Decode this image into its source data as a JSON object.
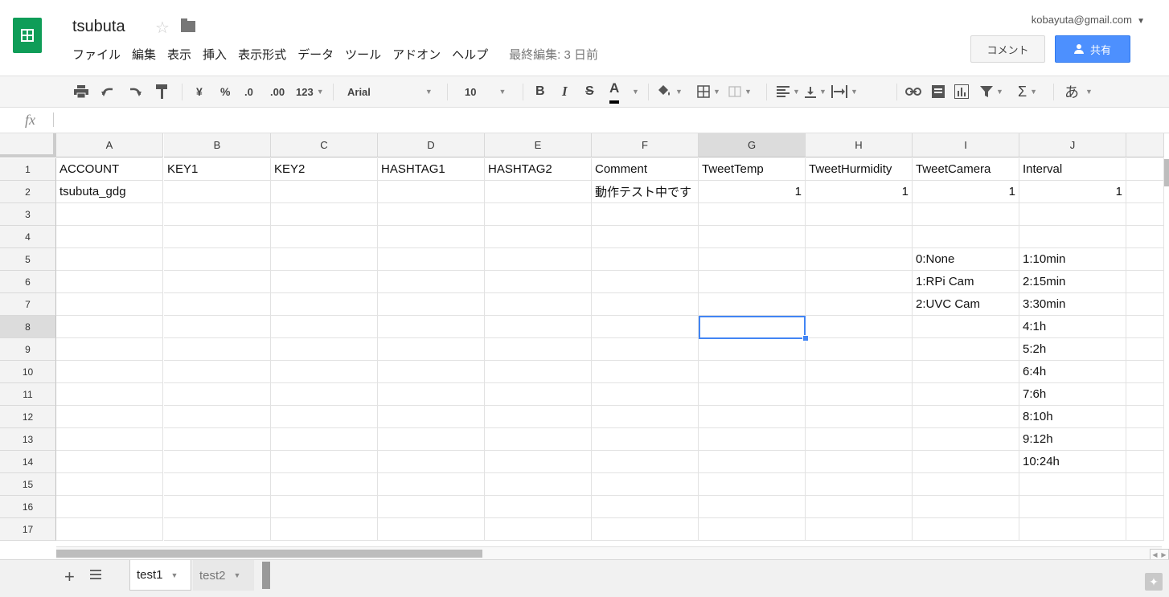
{
  "header": {
    "title": "tsubuta",
    "account": "kobayuta@gmail.com",
    "comment_label": "コメント",
    "share_label": "共有",
    "star_icon": "star-icon",
    "folder_icon": "folder-icon"
  },
  "menu": {
    "items": [
      "ファイル",
      "編集",
      "表示",
      "挿入",
      "表示形式",
      "データ",
      "ツール",
      "アドオン",
      "ヘルプ"
    ],
    "last_edit": "最終編集: 3 日前"
  },
  "toolbar": {
    "currency": "¥",
    "percent": "%",
    "dec_decrease": ".0",
    "dec_increase": ".00",
    "number_format": "123",
    "font": "Arial",
    "font_size": "10",
    "bold": "B",
    "italic": "I",
    "strike": "S",
    "text_color": "A",
    "sum": "Σ",
    "input_tools": "あ"
  },
  "formula_bar": {
    "fx": "fx",
    "value": ""
  },
  "grid": {
    "columns": [
      "A",
      "B",
      "C",
      "D",
      "E",
      "F",
      "G",
      "H",
      "I",
      "J"
    ],
    "active_column": "G",
    "active_row": "8",
    "rows": [
      {
        "num": "1",
        "cells": [
          "ACCOUNT",
          "KEY1",
          "KEY2",
          "HASHTAG1",
          "HASHTAG2",
          "Comment",
          "TweetTemp",
          "TweetHurmidity",
          "TweetCamera",
          "Interval"
        ]
      },
      {
        "num": "2",
        "cells": [
          "tsubuta_gdg",
          "",
          "",
          "",
          "",
          "動作テスト中です",
          "1",
          "1",
          "1",
          "1"
        ]
      },
      {
        "num": "3",
        "cells": [
          "",
          "",
          "",
          "",
          "",
          "",
          "",
          "",
          "",
          ""
        ]
      },
      {
        "num": "4",
        "cells": [
          "",
          "",
          "",
          "",
          "",
          "",
          "",
          "",
          "",
          ""
        ]
      },
      {
        "num": "5",
        "cells": [
          "",
          "",
          "",
          "",
          "",
          "",
          "",
          "",
          "0:None",
          "1:10min"
        ]
      },
      {
        "num": "6",
        "cells": [
          "",
          "",
          "",
          "",
          "",
          "",
          "",
          "",
          "1:RPi Cam",
          "2:15min"
        ]
      },
      {
        "num": "7",
        "cells": [
          "",
          "",
          "",
          "",
          "",
          "",
          "",
          "",
          "2:UVC Cam",
          "3:30min"
        ]
      },
      {
        "num": "8",
        "cells": [
          "",
          "",
          "",
          "",
          "",
          "",
          "",
          "",
          "",
          "4:1h"
        ]
      },
      {
        "num": "9",
        "cells": [
          "",
          "",
          "",
          "",
          "",
          "",
          "",
          "",
          "",
          "5:2h"
        ]
      },
      {
        "num": "10",
        "cells": [
          "",
          "",
          "",
          "",
          "",
          "",
          "",
          "",
          "",
          "6:4h"
        ]
      },
      {
        "num": "11",
        "cells": [
          "",
          "",
          "",
          "",
          "",
          "",
          "",
          "",
          "",
          "7:6h"
        ]
      },
      {
        "num": "12",
        "cells": [
          "",
          "",
          "",
          "",
          "",
          "",
          "",
          "",
          "",
          "8:10h"
        ]
      },
      {
        "num": "13",
        "cells": [
          "",
          "",
          "",
          "",
          "",
          "",
          "",
          "",
          "",
          "9:12h"
        ]
      },
      {
        "num": "14",
        "cells": [
          "",
          "",
          "",
          "",
          "",
          "",
          "",
          "",
          "",
          "10:24h"
        ]
      },
      {
        "num": "15",
        "cells": [
          "",
          "",
          "",
          "",
          "",
          "",
          "",
          "",
          "",
          ""
        ]
      },
      {
        "num": "16",
        "cells": [
          "",
          "",
          "",
          "",
          "",
          "",
          "",
          "",
          "",
          ""
        ]
      },
      {
        "num": "17",
        "cells": [
          "",
          "",
          "",
          "",
          "",
          "",
          "",
          "",
          "",
          ""
        ]
      }
    ]
  },
  "sheets": {
    "tabs": [
      "test1",
      "test2"
    ],
    "active": "test1",
    "add_icon": "plus-icon",
    "list_icon": "list-icon"
  },
  "colors": {
    "brand": "#0f9d58",
    "share": "#4d90fe",
    "selection": "#4285f4"
  }
}
